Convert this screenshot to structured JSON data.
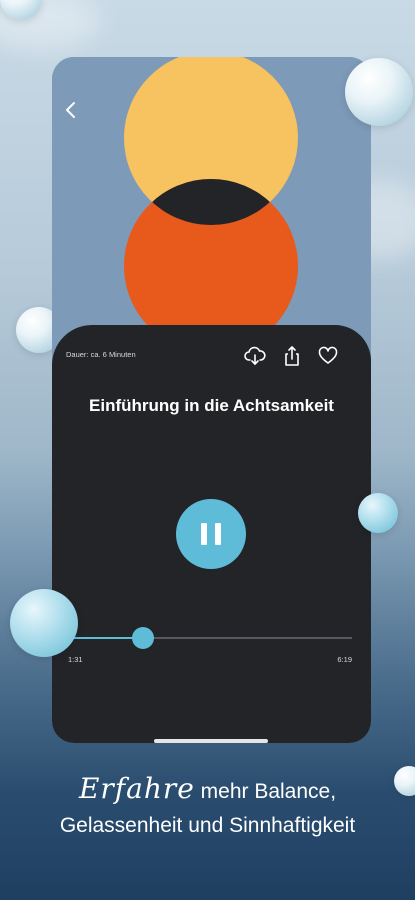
{
  "player": {
    "duration_label": "Dauer: ca. 6 Minuten",
    "title": "Einführung in die Achtsamkeit",
    "time_elapsed": "1:31",
    "time_total": "6:19",
    "progress_fraction": 0.265,
    "state": "playing"
  },
  "icons": {
    "back": "chevron-left-icon",
    "download": "cloud-download-icon",
    "share": "share-icon",
    "favorite": "heart-icon",
    "pause": "pause-icon"
  },
  "colors": {
    "accent": "#5fbcd9",
    "art_background": "#7d9ab9",
    "art_top_circle": "#f7c260",
    "art_bottom_circle": "#e8591c",
    "art_overlap": "#222427",
    "sheet_background": "#222427"
  },
  "caption": {
    "script_word": "Erfahre",
    "line1_rest": "mehr Balance,",
    "line2": "Gelassenheit und Sinnhaftigkeit"
  }
}
